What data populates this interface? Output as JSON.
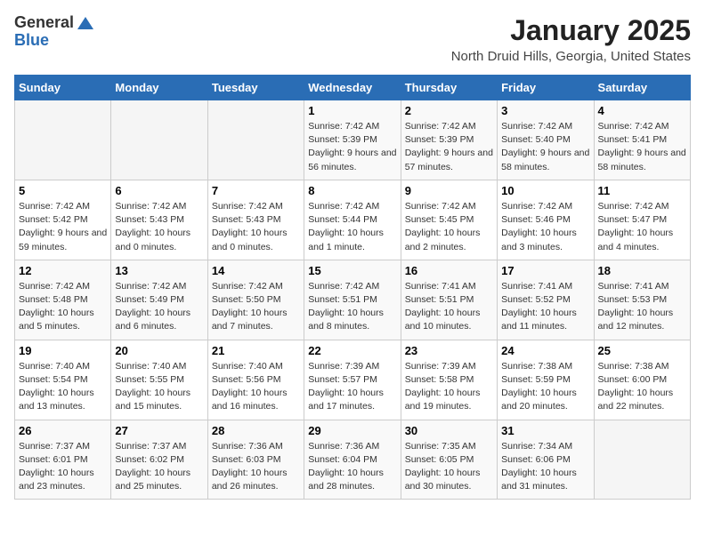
{
  "header": {
    "logo_general": "General",
    "logo_blue": "Blue",
    "title": "January 2025",
    "subtitle": "North Druid Hills, Georgia, United States"
  },
  "weekdays": [
    "Sunday",
    "Monday",
    "Tuesday",
    "Wednesday",
    "Thursday",
    "Friday",
    "Saturday"
  ],
  "weeks": [
    [
      {
        "day": "",
        "info": ""
      },
      {
        "day": "",
        "info": ""
      },
      {
        "day": "",
        "info": ""
      },
      {
        "day": "1",
        "info": "Sunrise: 7:42 AM\nSunset: 5:39 PM\nDaylight: 9 hours and 56 minutes."
      },
      {
        "day": "2",
        "info": "Sunrise: 7:42 AM\nSunset: 5:39 PM\nDaylight: 9 hours and 57 minutes."
      },
      {
        "day": "3",
        "info": "Sunrise: 7:42 AM\nSunset: 5:40 PM\nDaylight: 9 hours and 58 minutes."
      },
      {
        "day": "4",
        "info": "Sunrise: 7:42 AM\nSunset: 5:41 PM\nDaylight: 9 hours and 58 minutes."
      }
    ],
    [
      {
        "day": "5",
        "info": "Sunrise: 7:42 AM\nSunset: 5:42 PM\nDaylight: 9 hours and 59 minutes."
      },
      {
        "day": "6",
        "info": "Sunrise: 7:42 AM\nSunset: 5:43 PM\nDaylight: 10 hours and 0 minutes."
      },
      {
        "day": "7",
        "info": "Sunrise: 7:42 AM\nSunset: 5:43 PM\nDaylight: 10 hours and 0 minutes."
      },
      {
        "day": "8",
        "info": "Sunrise: 7:42 AM\nSunset: 5:44 PM\nDaylight: 10 hours and 1 minute."
      },
      {
        "day": "9",
        "info": "Sunrise: 7:42 AM\nSunset: 5:45 PM\nDaylight: 10 hours and 2 minutes."
      },
      {
        "day": "10",
        "info": "Sunrise: 7:42 AM\nSunset: 5:46 PM\nDaylight: 10 hours and 3 minutes."
      },
      {
        "day": "11",
        "info": "Sunrise: 7:42 AM\nSunset: 5:47 PM\nDaylight: 10 hours and 4 minutes."
      }
    ],
    [
      {
        "day": "12",
        "info": "Sunrise: 7:42 AM\nSunset: 5:48 PM\nDaylight: 10 hours and 5 minutes."
      },
      {
        "day": "13",
        "info": "Sunrise: 7:42 AM\nSunset: 5:49 PM\nDaylight: 10 hours and 6 minutes."
      },
      {
        "day": "14",
        "info": "Sunrise: 7:42 AM\nSunset: 5:50 PM\nDaylight: 10 hours and 7 minutes."
      },
      {
        "day": "15",
        "info": "Sunrise: 7:42 AM\nSunset: 5:51 PM\nDaylight: 10 hours and 8 minutes."
      },
      {
        "day": "16",
        "info": "Sunrise: 7:41 AM\nSunset: 5:51 PM\nDaylight: 10 hours and 10 minutes."
      },
      {
        "day": "17",
        "info": "Sunrise: 7:41 AM\nSunset: 5:52 PM\nDaylight: 10 hours and 11 minutes."
      },
      {
        "day": "18",
        "info": "Sunrise: 7:41 AM\nSunset: 5:53 PM\nDaylight: 10 hours and 12 minutes."
      }
    ],
    [
      {
        "day": "19",
        "info": "Sunrise: 7:40 AM\nSunset: 5:54 PM\nDaylight: 10 hours and 13 minutes."
      },
      {
        "day": "20",
        "info": "Sunrise: 7:40 AM\nSunset: 5:55 PM\nDaylight: 10 hours and 15 minutes."
      },
      {
        "day": "21",
        "info": "Sunrise: 7:40 AM\nSunset: 5:56 PM\nDaylight: 10 hours and 16 minutes."
      },
      {
        "day": "22",
        "info": "Sunrise: 7:39 AM\nSunset: 5:57 PM\nDaylight: 10 hours and 17 minutes."
      },
      {
        "day": "23",
        "info": "Sunrise: 7:39 AM\nSunset: 5:58 PM\nDaylight: 10 hours and 19 minutes."
      },
      {
        "day": "24",
        "info": "Sunrise: 7:38 AM\nSunset: 5:59 PM\nDaylight: 10 hours and 20 minutes."
      },
      {
        "day": "25",
        "info": "Sunrise: 7:38 AM\nSunset: 6:00 PM\nDaylight: 10 hours and 22 minutes."
      }
    ],
    [
      {
        "day": "26",
        "info": "Sunrise: 7:37 AM\nSunset: 6:01 PM\nDaylight: 10 hours and 23 minutes."
      },
      {
        "day": "27",
        "info": "Sunrise: 7:37 AM\nSunset: 6:02 PM\nDaylight: 10 hours and 25 minutes."
      },
      {
        "day": "28",
        "info": "Sunrise: 7:36 AM\nSunset: 6:03 PM\nDaylight: 10 hours and 26 minutes."
      },
      {
        "day": "29",
        "info": "Sunrise: 7:36 AM\nSunset: 6:04 PM\nDaylight: 10 hours and 28 minutes."
      },
      {
        "day": "30",
        "info": "Sunrise: 7:35 AM\nSunset: 6:05 PM\nDaylight: 10 hours and 30 minutes."
      },
      {
        "day": "31",
        "info": "Sunrise: 7:34 AM\nSunset: 6:06 PM\nDaylight: 10 hours and 31 minutes."
      },
      {
        "day": "",
        "info": ""
      }
    ]
  ]
}
